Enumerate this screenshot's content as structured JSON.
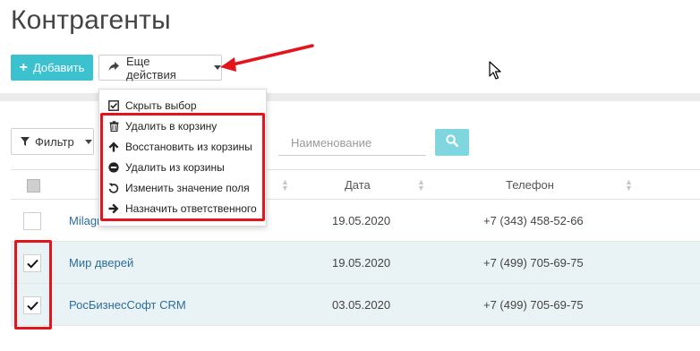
{
  "page_title": "Контрагенты",
  "toolbar": {
    "add_label": "Добавить",
    "more_label": "Еще действия"
  },
  "dropdown_menu": {
    "items": [
      {
        "label": "Скрыть выбор",
        "icon": "checkbox-icon"
      },
      {
        "label": "Удалить в корзину",
        "icon": "trash-icon"
      },
      {
        "label": "Восстановить из корзины",
        "icon": "arrow-up-icon"
      },
      {
        "label": "Удалить из корзины",
        "icon": "minus-circle-icon"
      },
      {
        "label": "Изменить значение поля",
        "icon": "undo-icon"
      },
      {
        "label": "Назначить ответственного",
        "icon": "arrow-right-icon"
      }
    ]
  },
  "filter": {
    "label": "Фильтр",
    "search_placeholder": "Наименование"
  },
  "table": {
    "columns": [
      "Дата",
      "Телефон"
    ],
    "rows": [
      {
        "name": "Milagro",
        "date": "19.05.2020",
        "phone": "+7 (343) 458-52-66",
        "checked": false
      },
      {
        "name": "Мир дверей",
        "date": "19.05.2020",
        "phone": "+7 (499) 705-69-75",
        "checked": true
      },
      {
        "name": "РосБизнесСофт CRM",
        "date": "03.05.2020",
        "phone": "+7 (499) 705-69-75",
        "checked": true
      }
    ]
  },
  "colors": {
    "accent": "#3cc2cf",
    "search_button": "#7fd6de",
    "annotation_red": "#e4141c",
    "link": "#2c6e98",
    "selected_row": "#e9f2f4"
  }
}
